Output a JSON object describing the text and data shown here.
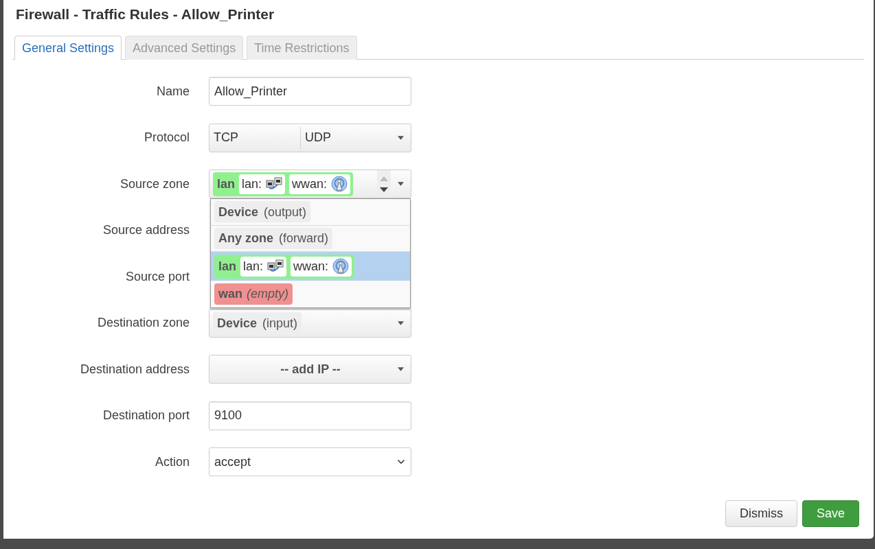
{
  "dialog": {
    "title": "Firewall - Traffic Rules - Allow_Printer"
  },
  "tabs": [
    {
      "label": "General Settings",
      "selected": true
    },
    {
      "label": "Advanced Settings",
      "selected": false
    },
    {
      "label": "Time Restrictions",
      "selected": false
    }
  ],
  "form": {
    "rows": [
      {
        "label": "Name",
        "kind": "text",
        "value": "Allow_Printer"
      },
      {
        "label": "Protocol",
        "kind": "multi",
        "values": [
          "TCP",
          "UDP"
        ]
      },
      {
        "label": "Source zone",
        "kind": "zone",
        "expanded": true,
        "value": {
          "kind": "zone",
          "name": "lan",
          "color": "#90f090",
          "networks": [
            {
              "label": "lan:",
              "kind": "wired"
            },
            {
              "label": "wwan:",
              "kind": "wireless"
            }
          ]
        },
        "options": [
          {
            "kind": "special",
            "name": "Device",
            "note": "(output)",
            "color": "#eeeeee",
            "selected": false
          },
          {
            "kind": "special",
            "name": "Any zone",
            "note": "(forward)",
            "color": "#eeeeee",
            "selected": false
          },
          {
            "kind": "zone",
            "name": "lan",
            "color": "#90f090",
            "networks": [
              {
                "label": "lan:",
                "kind": "wired"
              },
              {
                "label": "wwan:",
                "kind": "wireless"
              }
            ],
            "selected": true
          },
          {
            "kind": "zone",
            "name": "wan",
            "note": "(empty)",
            "color": "#f09090",
            "selected": false
          }
        ]
      },
      {
        "label": "Source address",
        "kind": "covered"
      },
      {
        "label": "Source port",
        "kind": "covered"
      },
      {
        "label": "Destination zone",
        "kind": "zone",
        "expanded": false,
        "value": {
          "kind": "special",
          "name": "Device",
          "note": "(input)",
          "color": "#eeeeee"
        }
      },
      {
        "label": "Destination address",
        "kind": "picker",
        "value": "-- add IP --"
      },
      {
        "label": "Destination port",
        "kind": "text",
        "value": "9100"
      },
      {
        "label": "Action",
        "kind": "select",
        "value": "accept"
      }
    ]
  },
  "buttons": [
    {
      "label": "Dismiss",
      "kind": "secondary"
    },
    {
      "label": "Save",
      "kind": "primary"
    }
  ]
}
